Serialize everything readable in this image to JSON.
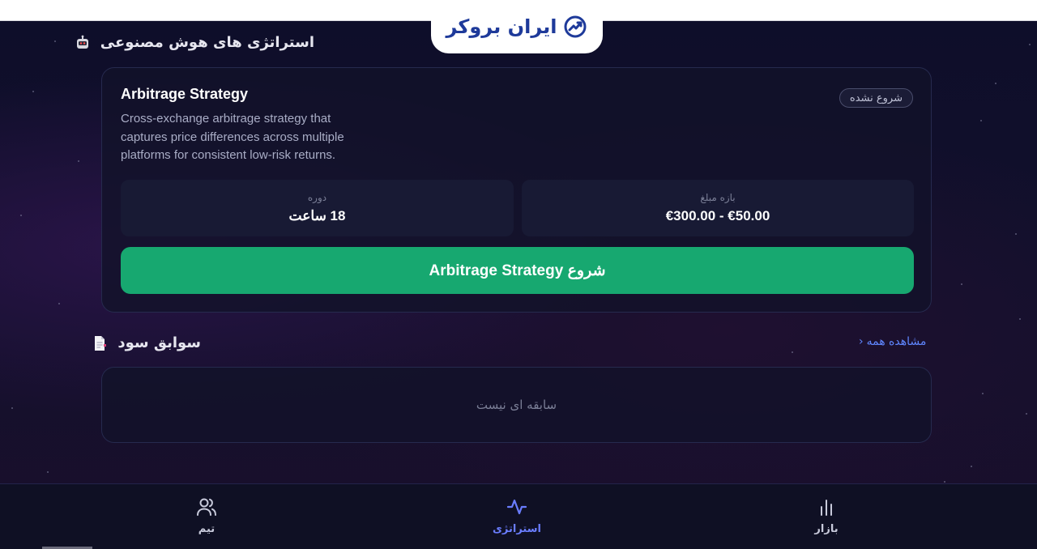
{
  "brand": {
    "name": "ایران بروکر",
    "color": "#1e3a9a"
  },
  "ai_section": {
    "title": "استراتژی های هوش مصنوعی",
    "icon": "robot-icon"
  },
  "strategy": {
    "name": "Arbitrage Strategy",
    "description": "Cross-exchange arbitrage strategy that captures price differences across multiple platforms for consistent low-risk returns.",
    "status": "شروع نشده",
    "duration_label": "دوره",
    "duration_value": "18 ساعت",
    "amount_label": "بازه مبلغ",
    "amount_value": "€50.00 - €300.00",
    "start_label": "شروع Arbitrage Strategy",
    "accent": "#17a870"
  },
  "profit_section": {
    "title": "سوابق سود",
    "icon": "document-icon",
    "view_all": "مشاهده همه",
    "empty": "سابقه ای نیست"
  },
  "nav": {
    "market": {
      "label": "بازار",
      "icon": "bar-chart-icon"
    },
    "strategy": {
      "label": "استراتژی",
      "icon": "activity-icon",
      "active": true,
      "color": "#6a7dff"
    },
    "team": {
      "label": "تیم",
      "icon": "users-icon"
    }
  }
}
